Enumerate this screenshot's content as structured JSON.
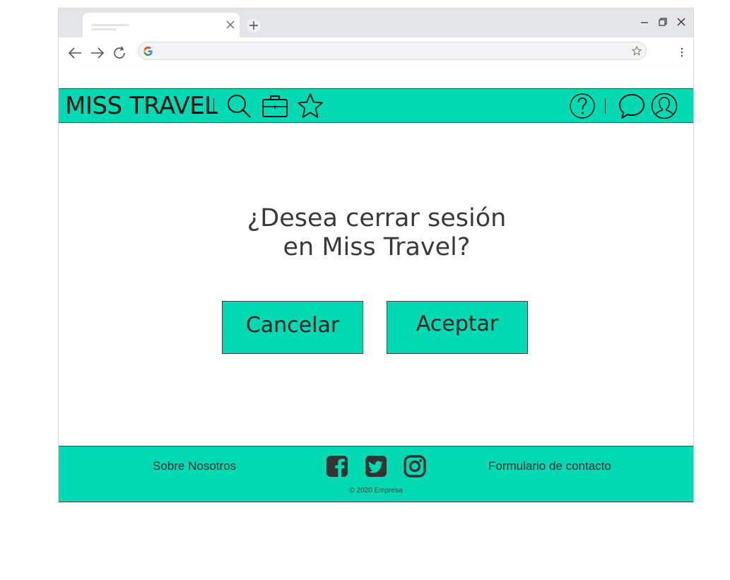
{
  "browser": {
    "tab_title": "",
    "address": ""
  },
  "header": {
    "brand": "MISS TRAVEL",
    "icons": [
      "search-icon",
      "briefcase-icon",
      "star-icon",
      "help-icon",
      "chat-icon",
      "user-icon"
    ]
  },
  "dialog": {
    "title_line1": "¿Desea cerrar sesión",
    "title_line2": "en Miss Travel?",
    "cancel_label": "Cancelar",
    "accept_label": "Aceptar"
  },
  "footer": {
    "about_label": "Sobre Nosotros",
    "contact_label": "Formulario de contacto",
    "copyright": "© 2020 Empresa",
    "social": [
      "facebook-icon",
      "twitter-icon",
      "instagram-icon"
    ]
  },
  "colors": {
    "accent": "#00d9b2",
    "text": "#3a3a3a",
    "border": "#444444"
  }
}
